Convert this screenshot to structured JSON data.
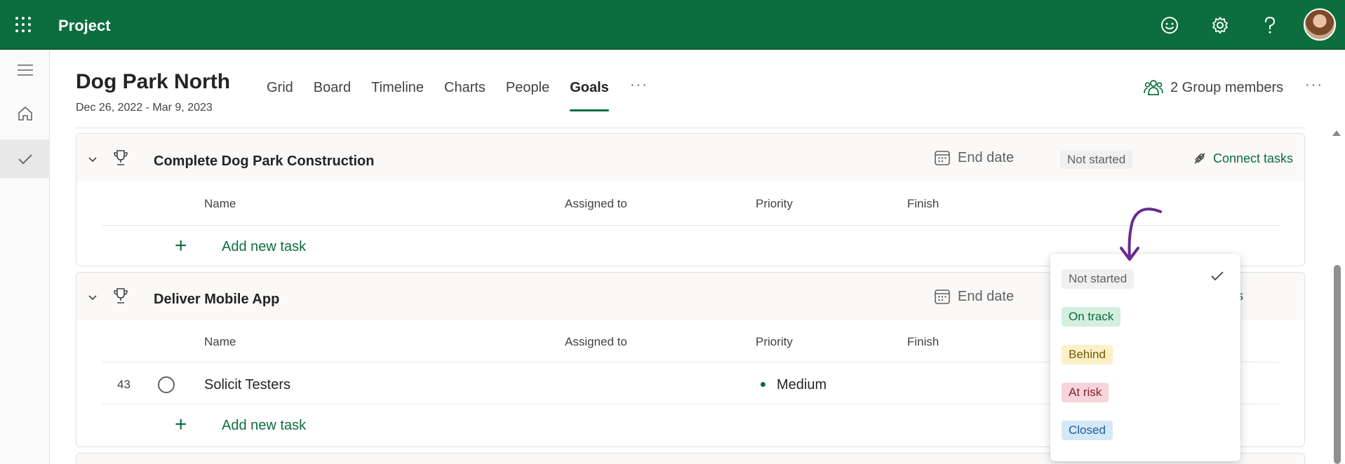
{
  "topbar": {
    "app_title": "Project",
    "waffle_icon": "app-launcher-icon",
    "icons": [
      "smiley-feedback-icon",
      "gear-icon",
      "help-icon"
    ],
    "avatar": "user-avatar"
  },
  "leftrail": {
    "items": [
      {
        "icon": "hamburger-menu-icon",
        "active": false
      },
      {
        "icon": "home-icon",
        "active": false
      },
      {
        "icon": "checkmark-icon",
        "active": true
      }
    ]
  },
  "project": {
    "title": "Dog Park North",
    "dates": "Dec 26, 2022 - Mar 9, 2023"
  },
  "tabs": [
    {
      "label": "Grid",
      "active": false
    },
    {
      "label": "Board",
      "active": false
    },
    {
      "label": "Timeline",
      "active": false
    },
    {
      "label": "Charts",
      "active": false
    },
    {
      "label": "People",
      "active": false
    },
    {
      "label": "Goals",
      "active": true
    }
  ],
  "tabs_more": "···",
  "group_members": "2 Group members",
  "header_more": "···",
  "columns": {
    "name": "Name",
    "assigned_to": "Assigned to",
    "priority": "Priority",
    "finish": "Finish"
  },
  "goals": [
    {
      "name": "Complete Dog Park Construction",
      "end_date_label": "End date",
      "status": "Not started",
      "connect_label": "Connect tasks",
      "add_task_label": "Add new task",
      "tasks": []
    },
    {
      "name": "Deliver Mobile App",
      "end_date_label": "End date",
      "connect_partial": "ks",
      "add_task_label": "Add new task",
      "tasks": [
        {
          "id": "43",
          "name": "Solicit Testers",
          "priority": "Medium"
        }
      ]
    }
  ],
  "status_dropdown": {
    "selected": "Not started",
    "options": [
      {
        "label": "Not started",
        "bg": "#f0f0f0",
        "fg": "#616161"
      },
      {
        "label": "On track",
        "bg": "#d4efdf",
        "fg": "#0b6a3b"
      },
      {
        "label": "Behind",
        "bg": "#fbf0c8",
        "fg": "#7a5a00"
      },
      {
        "label": "At risk",
        "bg": "#f6d5da",
        "fg": "#8a1c2c"
      },
      {
        "label": "Closed",
        "bg": "#d5e8f8",
        "fg": "#1a5c9a"
      }
    ]
  },
  "colors": {
    "brand_green": "#0c6e3e",
    "annotation_purple": "#6b2a8f"
  }
}
